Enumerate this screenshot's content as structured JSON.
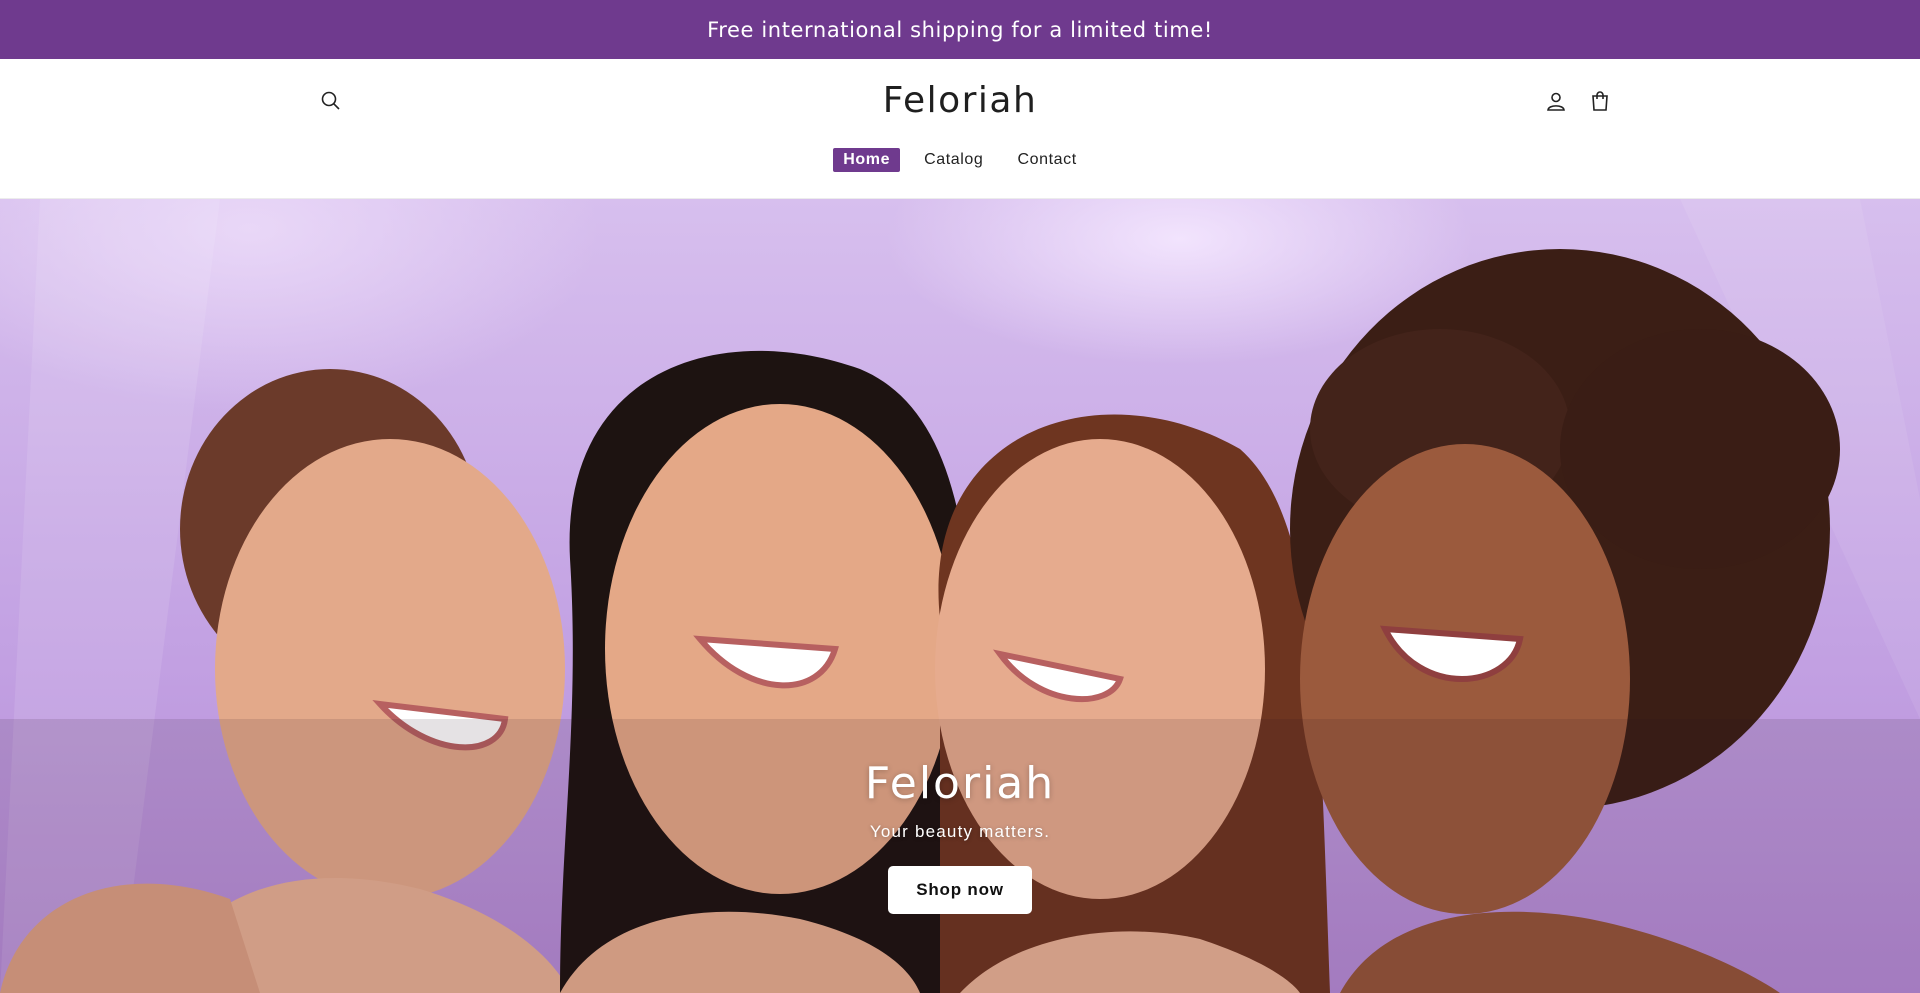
{
  "announcement": {
    "text": "Free international shipping for a limited time!"
  },
  "header": {
    "logo": "Feloriah",
    "icons": [
      "search-icon",
      "account-icon",
      "cart-icon"
    ],
    "nav": [
      {
        "label": "Home",
        "active": true
      },
      {
        "label": "Catalog",
        "active": false
      },
      {
        "label": "Contact",
        "active": false
      }
    ]
  },
  "hero": {
    "title": "Feloriah",
    "subtitle": "Your beauty matters.",
    "cta_label": "Shop now"
  },
  "colors": {
    "brand": "#6f3a8e",
    "hero_background": "#c3a2e3",
    "button_bg": "#ffffff"
  }
}
